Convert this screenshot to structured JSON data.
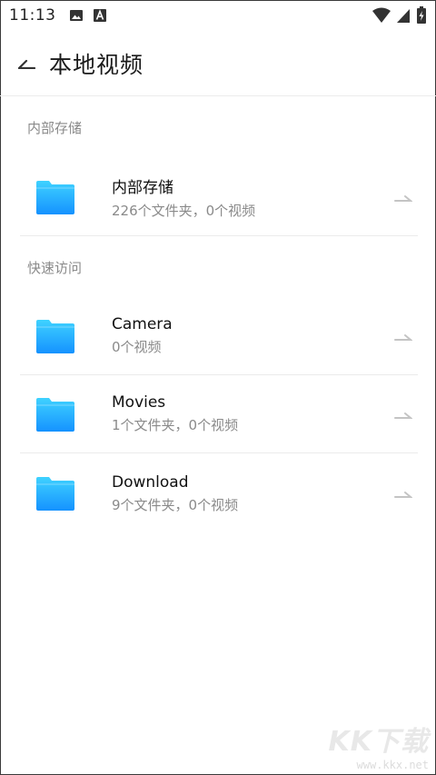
{
  "status_bar": {
    "time": "11:13",
    "icons": [
      "image-icon",
      "font-a-icon",
      "wifi-icon",
      "signal-icon",
      "battery-icon"
    ]
  },
  "header": {
    "title": "本地视频",
    "back_icon": "back-arrow-icon"
  },
  "sections": [
    {
      "title": "内部存储",
      "items": [
        {
          "name": "内部存储",
          "subtitle": "226个文件夹，0个视频"
        }
      ]
    },
    {
      "title": "快速访问",
      "items": [
        {
          "name": "Camera",
          "subtitle": "0个视频"
        },
        {
          "name": "Movies",
          "subtitle": "1个文件夹，0个视频"
        },
        {
          "name": "Download",
          "subtitle": "9个文件夹，0个视频"
        }
      ]
    }
  ],
  "watermark": {
    "logo": "KK下载",
    "url": "www.kkx.net"
  },
  "colors": {
    "folder_light": "#3fd2ff",
    "folder_dark": "#1592ff",
    "secondary_text": "#8a8a8a"
  }
}
